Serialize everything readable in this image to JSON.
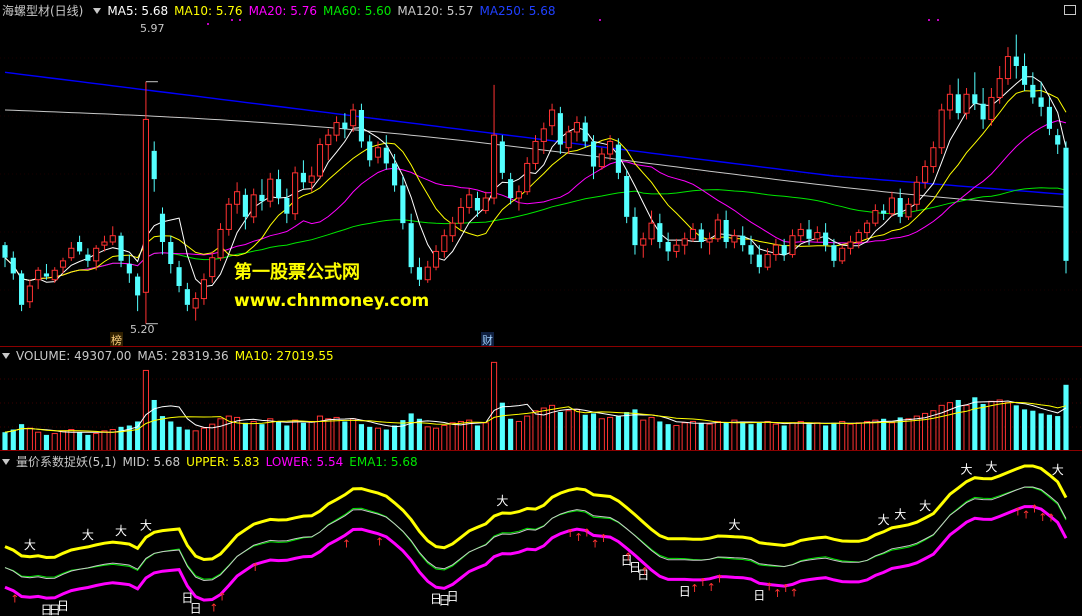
{
  "main": {
    "title": "海螺型材(日线)",
    "ma5_label": "MA5: 5.68",
    "ma10_label": "MA10: 5.76",
    "ma20_label": "MA20: 5.76",
    "ma60_label": "MA60: 5.60",
    "ma120_label": "MA120: 5.57",
    "ma250_label": "MA250: 5.68",
    "high_label": "5.97",
    "low_label": "5.20",
    "tag_bang": "榜",
    "tag_cai": "财",
    "watermark_title": "第一股票公式网",
    "watermark_url": "www.chnmoney.com"
  },
  "volume": {
    "label": "VOLUME: 49307.00",
    "ma5": "MA5: 28319.36",
    "ma10": "MA10: 27019.55"
  },
  "indicator": {
    "name": "量价系数捉妖(5,1)",
    "mid": "MID: 5.68",
    "upper": "UPPER: 5.83",
    "lower": "LOWER: 5.54",
    "ema1": "EMA1: 5.68",
    "big_char": "大",
    "day_char": "日",
    "arrow_char": "↑"
  },
  "colors": {
    "background": "#000000",
    "up": "#ff3232",
    "down": "#54ffff",
    "ma5": "#ffffff",
    "ma10": "#ffff00",
    "ma20": "#ff00ff",
    "ma60": "#00e600",
    "ma120": "#c8c8c8",
    "ma250": "#0000ff",
    "grid": "#8b0000"
  },
  "chart_data": {
    "type": "candlestick",
    "candles": [
      [
        5.45,
        5.46,
        5.38,
        5.41
      ],
      [
        5.41,
        5.43,
        5.34,
        5.36
      ],
      [
        5.36,
        5.37,
        5.24,
        5.26
      ],
      [
        5.27,
        5.34,
        5.25,
        5.32
      ],
      [
        5.34,
        5.38,
        5.31,
        5.37
      ],
      [
        5.36,
        5.39,
        5.34,
        5.35
      ],
      [
        5.34,
        5.38,
        5.33,
        5.37
      ],
      [
        5.38,
        5.41,
        5.36,
        5.4
      ],
      [
        5.41,
        5.46,
        5.4,
        5.44
      ],
      [
        5.46,
        5.48,
        5.42,
        5.43
      ],
      [
        5.42,
        5.44,
        5.38,
        5.4
      ],
      [
        5.4,
        5.45,
        5.37,
        5.44
      ],
      [
        5.45,
        5.48,
        5.43,
        5.46
      ],
      [
        5.46,
        5.51,
        5.45,
        5.48
      ],
      [
        5.48,
        5.49,
        5.38,
        5.4
      ],
      [
        5.39,
        5.42,
        5.33,
        5.36
      ],
      [
        5.35,
        5.36,
        5.24,
        5.29
      ],
      [
        5.3,
        5.97,
        5.2,
        5.85
      ],
      [
        5.75,
        5.78,
        5.62,
        5.66
      ],
      [
        5.55,
        5.57,
        5.42,
        5.46
      ],
      [
        5.46,
        5.48,
        5.36,
        5.39
      ],
      [
        5.38,
        5.4,
        5.3,
        5.32
      ],
      [
        5.31,
        5.33,
        5.24,
        5.26
      ],
      [
        5.25,
        5.3,
        5.21,
        5.28
      ],
      [
        5.28,
        5.36,
        5.26,
        5.34
      ],
      [
        5.35,
        5.43,
        5.33,
        5.41
      ],
      [
        5.41,
        5.52,
        5.4,
        5.5
      ],
      [
        5.5,
        5.6,
        5.48,
        5.58
      ],
      [
        5.58,
        5.65,
        5.55,
        5.62
      ],
      [
        5.61,
        5.63,
        5.5,
        5.54
      ],
      [
        5.54,
        5.63,
        5.52,
        5.61
      ],
      [
        5.61,
        5.66,
        5.56,
        5.59
      ],
      [
        5.59,
        5.68,
        5.57,
        5.66
      ],
      [
        5.66,
        5.69,
        5.58,
        5.6
      ],
      [
        5.6,
        5.63,
        5.52,
        5.55
      ],
      [
        5.55,
        5.7,
        5.53,
        5.68
      ],
      [
        5.68,
        5.72,
        5.63,
        5.65
      ],
      [
        5.65,
        5.7,
        5.62,
        5.67
      ],
      [
        5.67,
        5.79,
        5.66,
        5.77
      ],
      [
        5.77,
        5.82,
        5.72,
        5.8
      ],
      [
        5.8,
        5.86,
        5.78,
        5.84
      ],
      [
        5.84,
        5.87,
        5.79,
        5.82
      ],
      [
        5.83,
        5.9,
        5.81,
        5.88
      ],
      [
        5.88,
        5.9,
        5.76,
        5.78
      ],
      [
        5.78,
        5.8,
        5.7,
        5.72
      ],
      [
        5.73,
        5.78,
        5.71,
        5.76
      ],
      [
        5.76,
        5.8,
        5.69,
        5.71
      ],
      [
        5.71,
        5.74,
        5.62,
        5.64
      ],
      [
        5.64,
        5.67,
        5.5,
        5.52
      ],
      [
        5.52,
        5.55,
        5.36,
        5.38
      ],
      [
        5.38,
        5.41,
        5.32,
        5.34
      ],
      [
        5.34,
        5.4,
        5.33,
        5.38
      ],
      [
        5.38,
        5.45,
        5.37,
        5.43
      ],
      [
        5.43,
        5.5,
        5.41,
        5.48
      ],
      [
        5.48,
        5.54,
        5.46,
        5.52
      ],
      [
        5.52,
        5.6,
        5.5,
        5.57
      ],
      [
        5.57,
        5.63,
        5.55,
        5.61
      ],
      [
        5.6,
        5.62,
        5.54,
        5.56
      ],
      [
        5.56,
        5.62,
        5.55,
        5.6
      ],
      [
        5.6,
        5.96,
        5.58,
        5.8
      ],
      [
        5.78,
        5.8,
        5.66,
        5.68
      ],
      [
        5.66,
        5.68,
        5.58,
        5.6
      ],
      [
        5.6,
        5.64,
        5.56,
        5.62
      ],
      [
        5.62,
        5.73,
        5.61,
        5.71
      ],
      [
        5.71,
        5.8,
        5.69,
        5.78
      ],
      [
        5.78,
        5.84,
        5.74,
        5.82
      ],
      [
        5.83,
        5.9,
        5.8,
        5.88
      ],
      [
        5.87,
        5.89,
        5.74,
        5.77
      ],
      [
        5.76,
        5.83,
        5.74,
        5.81
      ],
      [
        5.81,
        5.86,
        5.78,
        5.84
      ],
      [
        5.84,
        5.86,
        5.76,
        5.78
      ],
      [
        5.78,
        5.8,
        5.66,
        5.7
      ],
      [
        5.7,
        5.76,
        5.69,
        5.74
      ],
      [
        5.74,
        5.8,
        5.72,
        5.78
      ],
      [
        5.77,
        5.79,
        5.66,
        5.68
      ],
      [
        5.67,
        5.69,
        5.52,
        5.54
      ],
      [
        5.54,
        5.57,
        5.42,
        5.45
      ],
      [
        5.45,
        5.49,
        5.41,
        5.47
      ],
      [
        5.47,
        5.56,
        5.45,
        5.52
      ],
      [
        5.52,
        5.55,
        5.44,
        5.46
      ],
      [
        5.46,
        5.49,
        5.4,
        5.43
      ],
      [
        5.43,
        5.47,
        5.41,
        5.45
      ],
      [
        5.45,
        5.49,
        5.42,
        5.47
      ],
      [
        5.47,
        5.52,
        5.46,
        5.5
      ],
      [
        5.5,
        5.52,
        5.44,
        5.46
      ],
      [
        5.46,
        5.49,
        5.42,
        5.47
      ],
      [
        5.47,
        5.55,
        5.46,
        5.53
      ],
      [
        5.53,
        5.56,
        5.44,
        5.46
      ],
      [
        5.46,
        5.5,
        5.44,
        5.48
      ],
      [
        5.48,
        5.51,
        5.43,
        5.45
      ],
      [
        5.45,
        5.48,
        5.39,
        5.42
      ],
      [
        5.42,
        5.45,
        5.36,
        5.38
      ],
      [
        5.38,
        5.44,
        5.37,
        5.42
      ],
      [
        5.42,
        5.47,
        5.4,
        5.45
      ],
      [
        5.45,
        5.47,
        5.4,
        5.42
      ],
      [
        5.42,
        5.5,
        5.41,
        5.48
      ],
      [
        5.48,
        5.52,
        5.46,
        5.5
      ],
      [
        5.5,
        5.53,
        5.45,
        5.47
      ],
      [
        5.47,
        5.51,
        5.46,
        5.49
      ],
      [
        5.49,
        5.52,
        5.43,
        5.45
      ],
      [
        5.45,
        5.47,
        5.38,
        5.4
      ],
      [
        5.4,
        5.45,
        5.39,
        5.44
      ],
      [
        5.44,
        5.48,
        5.42,
        5.46
      ],
      [
        5.46,
        5.5,
        5.44,
        5.49
      ],
      [
        5.49,
        5.53,
        5.47,
        5.52
      ],
      [
        5.52,
        5.58,
        5.51,
        5.56
      ],
      [
        5.56,
        5.58,
        5.53,
        5.55
      ],
      [
        5.55,
        5.62,
        5.54,
        5.6
      ],
      [
        5.6,
        5.63,
        5.52,
        5.54
      ],
      [
        5.54,
        5.6,
        5.53,
        5.58
      ],
      [
        5.58,
        5.67,
        5.56,
        5.65
      ],
      [
        5.65,
        5.72,
        5.63,
        5.7
      ],
      [
        5.7,
        5.78,
        5.68,
        5.76
      ],
      [
        5.76,
        5.9,
        5.74,
        5.88
      ],
      [
        5.88,
        5.96,
        5.85,
        5.93
      ],
      [
        5.93,
        5.98,
        5.85,
        5.87
      ],
      [
        5.87,
        5.95,
        5.85,
        5.93
      ],
      [
        5.93,
        6.0,
        5.88,
        5.9
      ],
      [
        5.9,
        5.95,
        5.82,
        5.85
      ],
      [
        5.85,
        5.95,
        5.83,
        5.92
      ],
      [
        5.92,
        6.02,
        5.9,
        5.98
      ],
      [
        5.98,
        6.08,
        5.96,
        6.05
      ],
      [
        6.05,
        6.12,
        5.98,
        6.02
      ],
      [
        6.02,
        6.06,
        5.94,
        5.96
      ],
      [
        5.96,
        6.0,
        5.9,
        5.92
      ],
      [
        5.92,
        5.97,
        5.86,
        5.89
      ],
      [
        5.89,
        5.92,
        5.8,
        5.82
      ],
      [
        5.8,
        5.82,
        5.74,
        5.77
      ],
      [
        5.76,
        5.78,
        5.36,
        5.4
      ]
    ],
    "volume": [
      14000,
      16000,
      20000,
      17000,
      14000,
      12000,
      13000,
      15000,
      16000,
      14000,
      12000,
      13000,
      15000,
      16000,
      18000,
      19000,
      22000,
      60000,
      38000,
      26000,
      22000,
      18000,
      16000,
      15000,
      17000,
      20000,
      24000,
      26000,
      25000,
      21000,
      22000,
      20000,
      24000,
      22000,
      19000,
      23000,
      21000,
      22000,
      26000,
      24000,
      25000,
      22000,
      24000,
      20000,
      18000,
      17000,
      16000,
      19000,
      23000,
      28000,
      24000,
      18000,
      17000,
      19000,
      21000,
      22000,
      23000,
      19000,
      21000,
      66000,
      36000,
      24000,
      22000,
      26000,
      30000,
      32000,
      34000,
      29000,
      30000,
      31000,
      27000,
      28000,
      24000,
      25000,
      26000,
      29000,
      31000,
      23000,
      25000,
      22000,
      20000,
      19000,
      21000,
      22000,
      21000,
      20000,
      22000,
      21000,
      23000,
      22000,
      20000,
      21000,
      22000,
      20000,
      19000,
      21000,
      22000,
      20000,
      21000,
      19000,
      21000,
      22000,
      20000,
      21000,
      22000,
      23000,
      24000,
      21000,
      25000,
      24000,
      26000,
      28000,
      30000,
      34000,
      36000,
      38000,
      34000,
      40000,
      35000,
      37000,
      38000,
      36000,
      34000,
      31000,
      30000,
      28000,
      27000,
      26000,
      49307
    ],
    "ylim": [
      5.18,
      6.16
    ],
    "high_marker": 5.97,
    "low_marker": 5.2,
    "indicator_ylim": [
      5.1,
      6.1
    ]
  }
}
